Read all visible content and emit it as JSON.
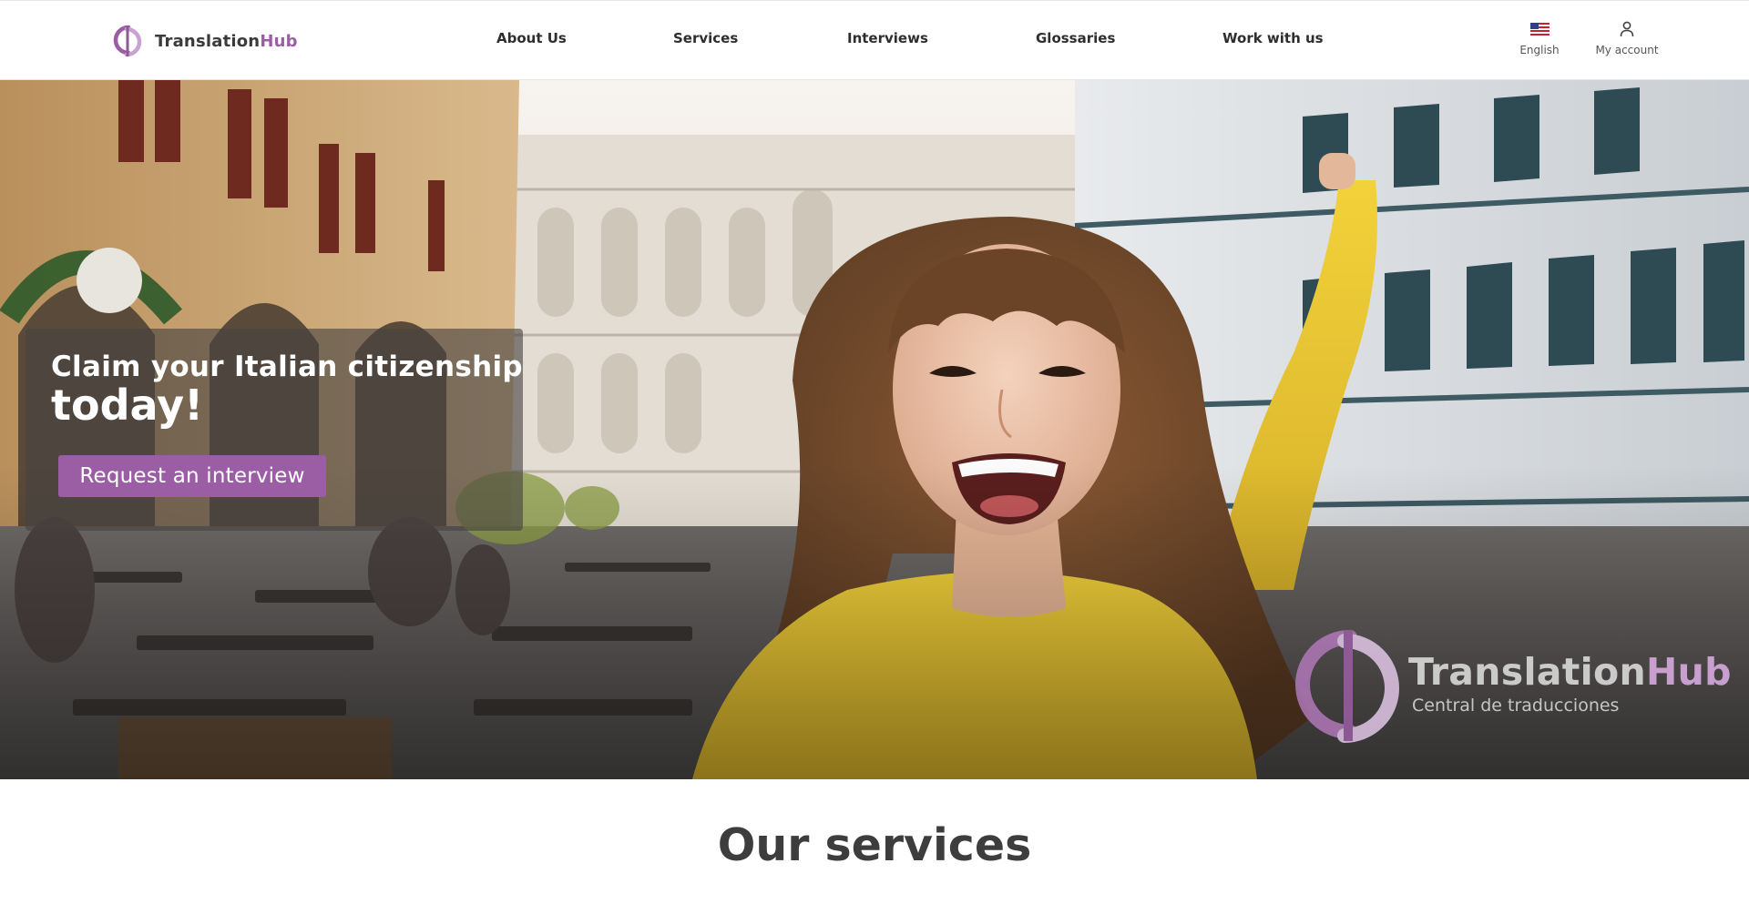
{
  "brand": {
    "name_part1": "Translation",
    "name_part2": "Hub",
    "accent_color": "#9b5ea5"
  },
  "nav": {
    "items": [
      {
        "label": "About Us"
      },
      {
        "label": "Services"
      },
      {
        "label": "Interviews"
      },
      {
        "label": "Glossaries"
      },
      {
        "label": "Work with us"
      }
    ]
  },
  "utility": {
    "language_label": "English",
    "language_icon": "us-flag-icon",
    "account_label": "My account",
    "account_icon": "user-icon"
  },
  "hero": {
    "headline_line1": "Claim your Italian citizenship",
    "headline_line2": "today!",
    "cta_label": "Request an interview",
    "cta_color": "#9b5ea5",
    "watermark_name_part1": "Translation",
    "watermark_name_part2": "Hub",
    "watermark_tagline": "Central de traducciones"
  },
  "services": {
    "title": "Our services"
  }
}
